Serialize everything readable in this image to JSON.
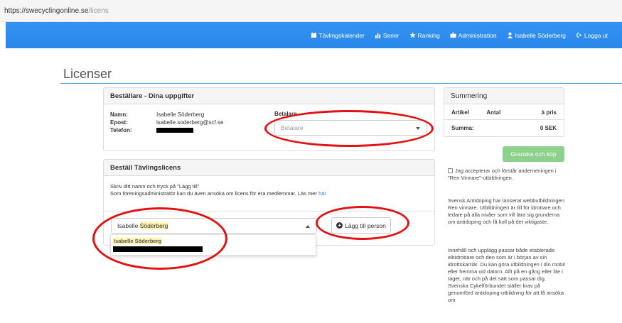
{
  "browser": {
    "url_host": "https://swecyclingonline.se",
    "url_path": "/licens"
  },
  "nav": {
    "items": [
      {
        "label": "Tävlingskalender",
        "icon": "calendar-icon"
      },
      {
        "label": "Serier",
        "icon": "bar-chart-icon"
      },
      {
        "label": "Ranking",
        "icon": "star-icon"
      },
      {
        "label": "Administration",
        "icon": "briefcase-icon"
      },
      {
        "label": "Isabelle Söderberg",
        "icon": "user-icon"
      },
      {
        "label": "Logga ut",
        "icon": "logout-icon"
      }
    ],
    "bg_color": "#2d8df0"
  },
  "page": {
    "title": "Licenser"
  },
  "orderer": {
    "heading": "Beställare - Dina uppgifter",
    "name_label": "Namn:",
    "name_value": "Isabelle Söderberg",
    "email_label": "Epost:",
    "email_value": "isabelle.soderberg@scf.se",
    "phone_label": "Telefon:",
    "payer_label": "Betalare",
    "payer_placeholder": "Betalare"
  },
  "license": {
    "heading": "Beställ Tävlingslicens",
    "help_line1": "Skriv ditt namn och tryck på \"Lägg till\"",
    "help_line2": "Som föreningsadministratör kan du även ansöka om licens för era medlemmar. Läs mer",
    "help_link": "här",
    "search_value_part1": "Isabelle ",
    "search_value_part2": "Söderberg",
    "add_button": "Lägg till person",
    "dropdown_item": "Isabelle Söderberg"
  },
  "summary": {
    "heading": "Summering",
    "col_article": "Artikel",
    "col_qty": "Antal",
    "col_price": "à pris",
    "total_label": "Summa:",
    "total_value": "0 SEK",
    "buy_button": "Granska och köp"
  },
  "sidebar": {
    "consent": "Jag accepterar och förstår andemeningen i \"Ren Vinnare\"-utbildningen.",
    "para1": "Svensk Antidoping har lanserat webbutbildningen Ren vinnare. Utbildningen är till för idrottare och ledare på alla nivåer som vill lära sig grunderna om antidoping och få koll på det viktigaste.",
    "para2": "Innehåll och upplägg passar både etablerade elitidrottare och den som är i början av sin idrottskarriär. Du kan göra utbildningen i din mobil eller hemma vid datorn. Allt på en gång eller lite i taget, när och på det sätt som passar dig. Svenska Cykelförbundet ställer krav på genomförd antidoping-utbildning för att få ansöka om"
  },
  "colors": {
    "annotation": "#e51010",
    "buy_button": "#8cd28c",
    "link": "#2d7fd6"
  }
}
